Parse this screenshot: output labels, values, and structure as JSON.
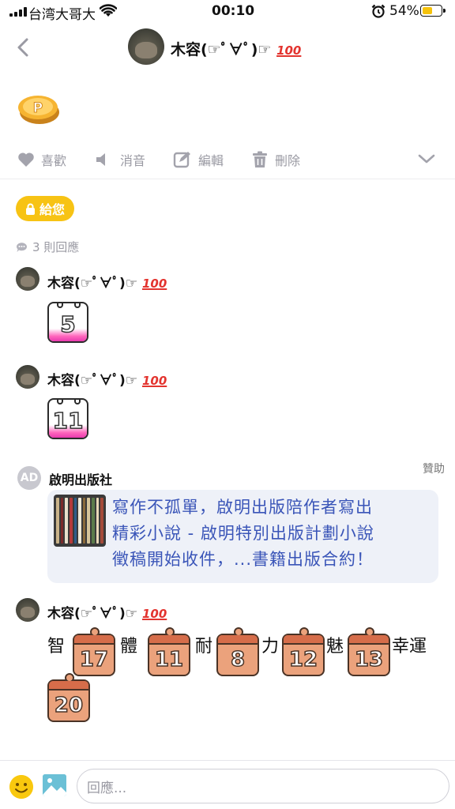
{
  "status_bar": {
    "carrier": "台湾大哥大",
    "time": "00:10",
    "battery_pct": "54%",
    "battery_color": "#f5c20b"
  },
  "header": {
    "author_name": "木容(☞ﾟ∀ﾟ)☞",
    "author_badge": "100",
    "back_icon": "chevron-left-icon"
  },
  "post": {
    "icon": "gold-coin-p-icon"
  },
  "actions": {
    "like": "喜歡",
    "mute": "消音",
    "edit": "編輯",
    "delete": "刪除"
  },
  "give_button": {
    "label": "給您",
    "color": "#f7c314"
  },
  "replies_count": "3 則回應",
  "comments": [
    {
      "name": "木容(☞ﾟ∀ﾟ)☞",
      "badge": "100",
      "calendar_number": "5"
    },
    {
      "name": "木容(☞ﾟ∀ﾟ)☞",
      "badge": "100",
      "calendar_number": "11"
    }
  ],
  "ad": {
    "avatar_text": "AD",
    "advertiser": "啟明出版社",
    "sponsor_label": "贊助",
    "line1": "寫作不孤單，啟明出版陪作者寫出",
    "line2": "精彩小說 - 啟明特別出版計劃小說",
    "line3": "徵稿開始收件，...書籍出版合約！",
    "link_color": "#3a55b8"
  },
  "stats_comment": {
    "name": "木容(☞ﾟ∀ﾟ)☞",
    "badge": "100",
    "items": [
      {
        "label": "智",
        "value": "17"
      },
      {
        "label": "體",
        "value": "11"
      },
      {
        "label": "耐",
        "value": "8"
      },
      {
        "label": "力",
        "value": "12"
      },
      {
        "label": "魅",
        "value": "13"
      },
      {
        "label": "幸運",
        "value": "20"
      }
    ]
  },
  "composer": {
    "placeholder": "回應...",
    "emoji_icon": "smiley-icon",
    "photo_icon": "photo-icon"
  }
}
